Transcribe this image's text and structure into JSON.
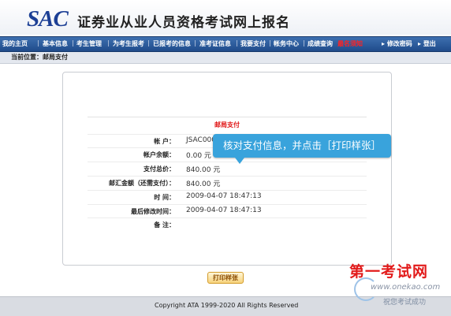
{
  "header": {
    "logo": "SAC",
    "title": "证券业从业人员资格考试网上报名"
  },
  "nav": {
    "items": [
      "我的主页",
      "基本信息",
      "考生管理",
      "为考生报考",
      "已报考的信息",
      "准考证信息",
      "我要支付",
      "帐务中心",
      "成绩查询",
      "最名须知"
    ],
    "right": [
      "修改密码",
      "登出"
    ]
  },
  "breadcrumb": "当前位置：邮局支付",
  "form": {
    "title": "邮局支付",
    "rows": [
      {
        "label": "帐      户：",
        "value": "JSAC0000"
      },
      {
        "label": "帐户余额：",
        "value": "0.00 元"
      },
      {
        "label": "支付总价：",
        "value": "840.00 元"
      },
      {
        "label": "邮汇金额（还需支付）：",
        "value": "840.00 元"
      },
      {
        "label": "时      间：",
        "value": "2009-04-07 18:47:13"
      },
      {
        "label": "最后修改时间：",
        "value": "2009-04-07 18:47:13"
      },
      {
        "label": "备      注：",
        "value": ""
      }
    ]
  },
  "tooltip": "核对支付信息，并点击［打印样张］",
  "print_button": "打印样张",
  "footer": "Copyright ATA 1999-2020  All Rights Reserved",
  "watermark": {
    "name": "第一考试网",
    "url": "www.onekao.com",
    "slogan": "祝您考试成功"
  }
}
